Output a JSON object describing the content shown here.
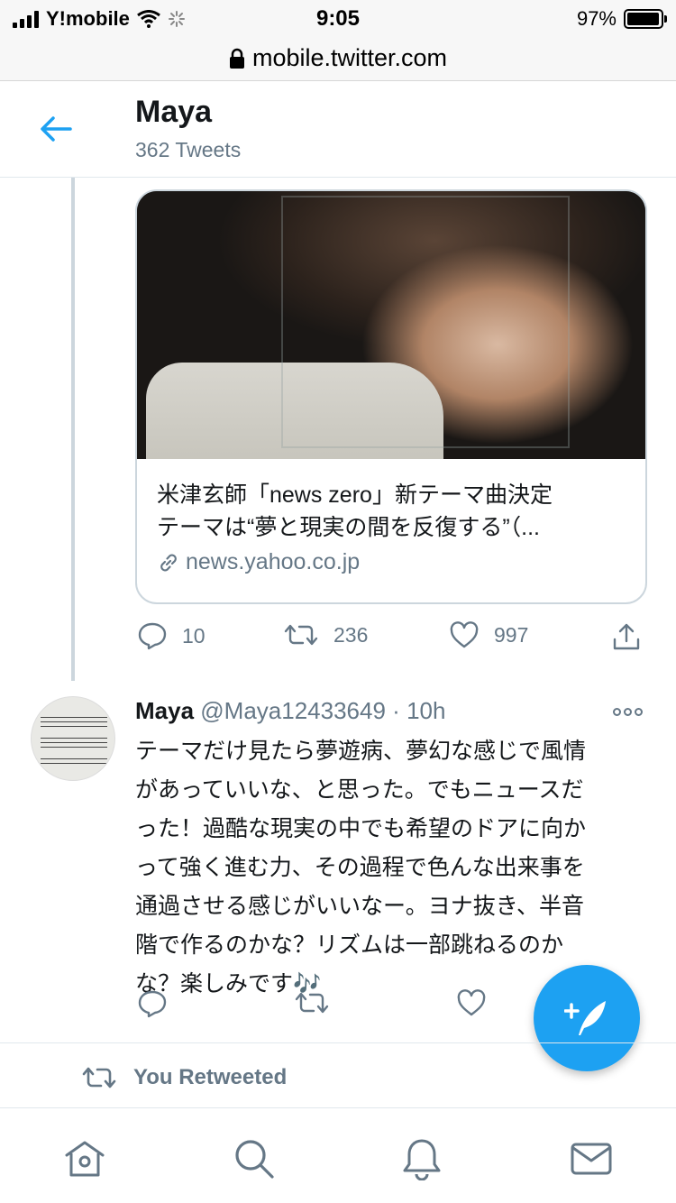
{
  "status_bar": {
    "carrier": "Y!mobile",
    "time": "9:05",
    "battery": "97%",
    "battery_level": 0.97
  },
  "url_bar": {
    "domain": "mobile.twitter.com"
  },
  "header": {
    "name": "Maya",
    "tweet_count": "362 Tweets"
  },
  "link_card": {
    "title_line1": "米津玄師「news zero」新テーマ曲決定",
    "title_line2": "テーマは“夢と現実の間を反復する”（...",
    "domain": "news.yahoo.co.jp"
  },
  "tweet1_actions": {
    "replies": "10",
    "retweets": "236",
    "likes": "997"
  },
  "tweet2": {
    "name": "Maya",
    "handle": "@Maya12433649",
    "separator": "·",
    "time": "10h",
    "lines": [
      "テーマだけ見たら夢遊病、夢幻な感じで風情",
      "があっていいな、と思った。でもニュースだ",
      "った！過酷な現実の中でも希望のドアに向か",
      "って強く進む力、その過程で色んな出来事を",
      "通過させる感じがいいなー。ヨナ抜き、半音",
      "階で作るのかな？リズムは一部跳ねるのか",
      "な？楽しみです🎶"
    ]
  },
  "retweet_label": "You Retweeted",
  "colors": {
    "accent": "#1da1f2",
    "secondary_text": "#657786",
    "border": "#ccd6dd"
  },
  "icons": [
    "back-arrow-icon",
    "lock-icon",
    "reply-icon",
    "retweet-icon",
    "like-icon",
    "share-icon",
    "more-icon",
    "compose-icon",
    "home-icon",
    "search-icon",
    "notifications-icon",
    "messages-icon"
  ]
}
